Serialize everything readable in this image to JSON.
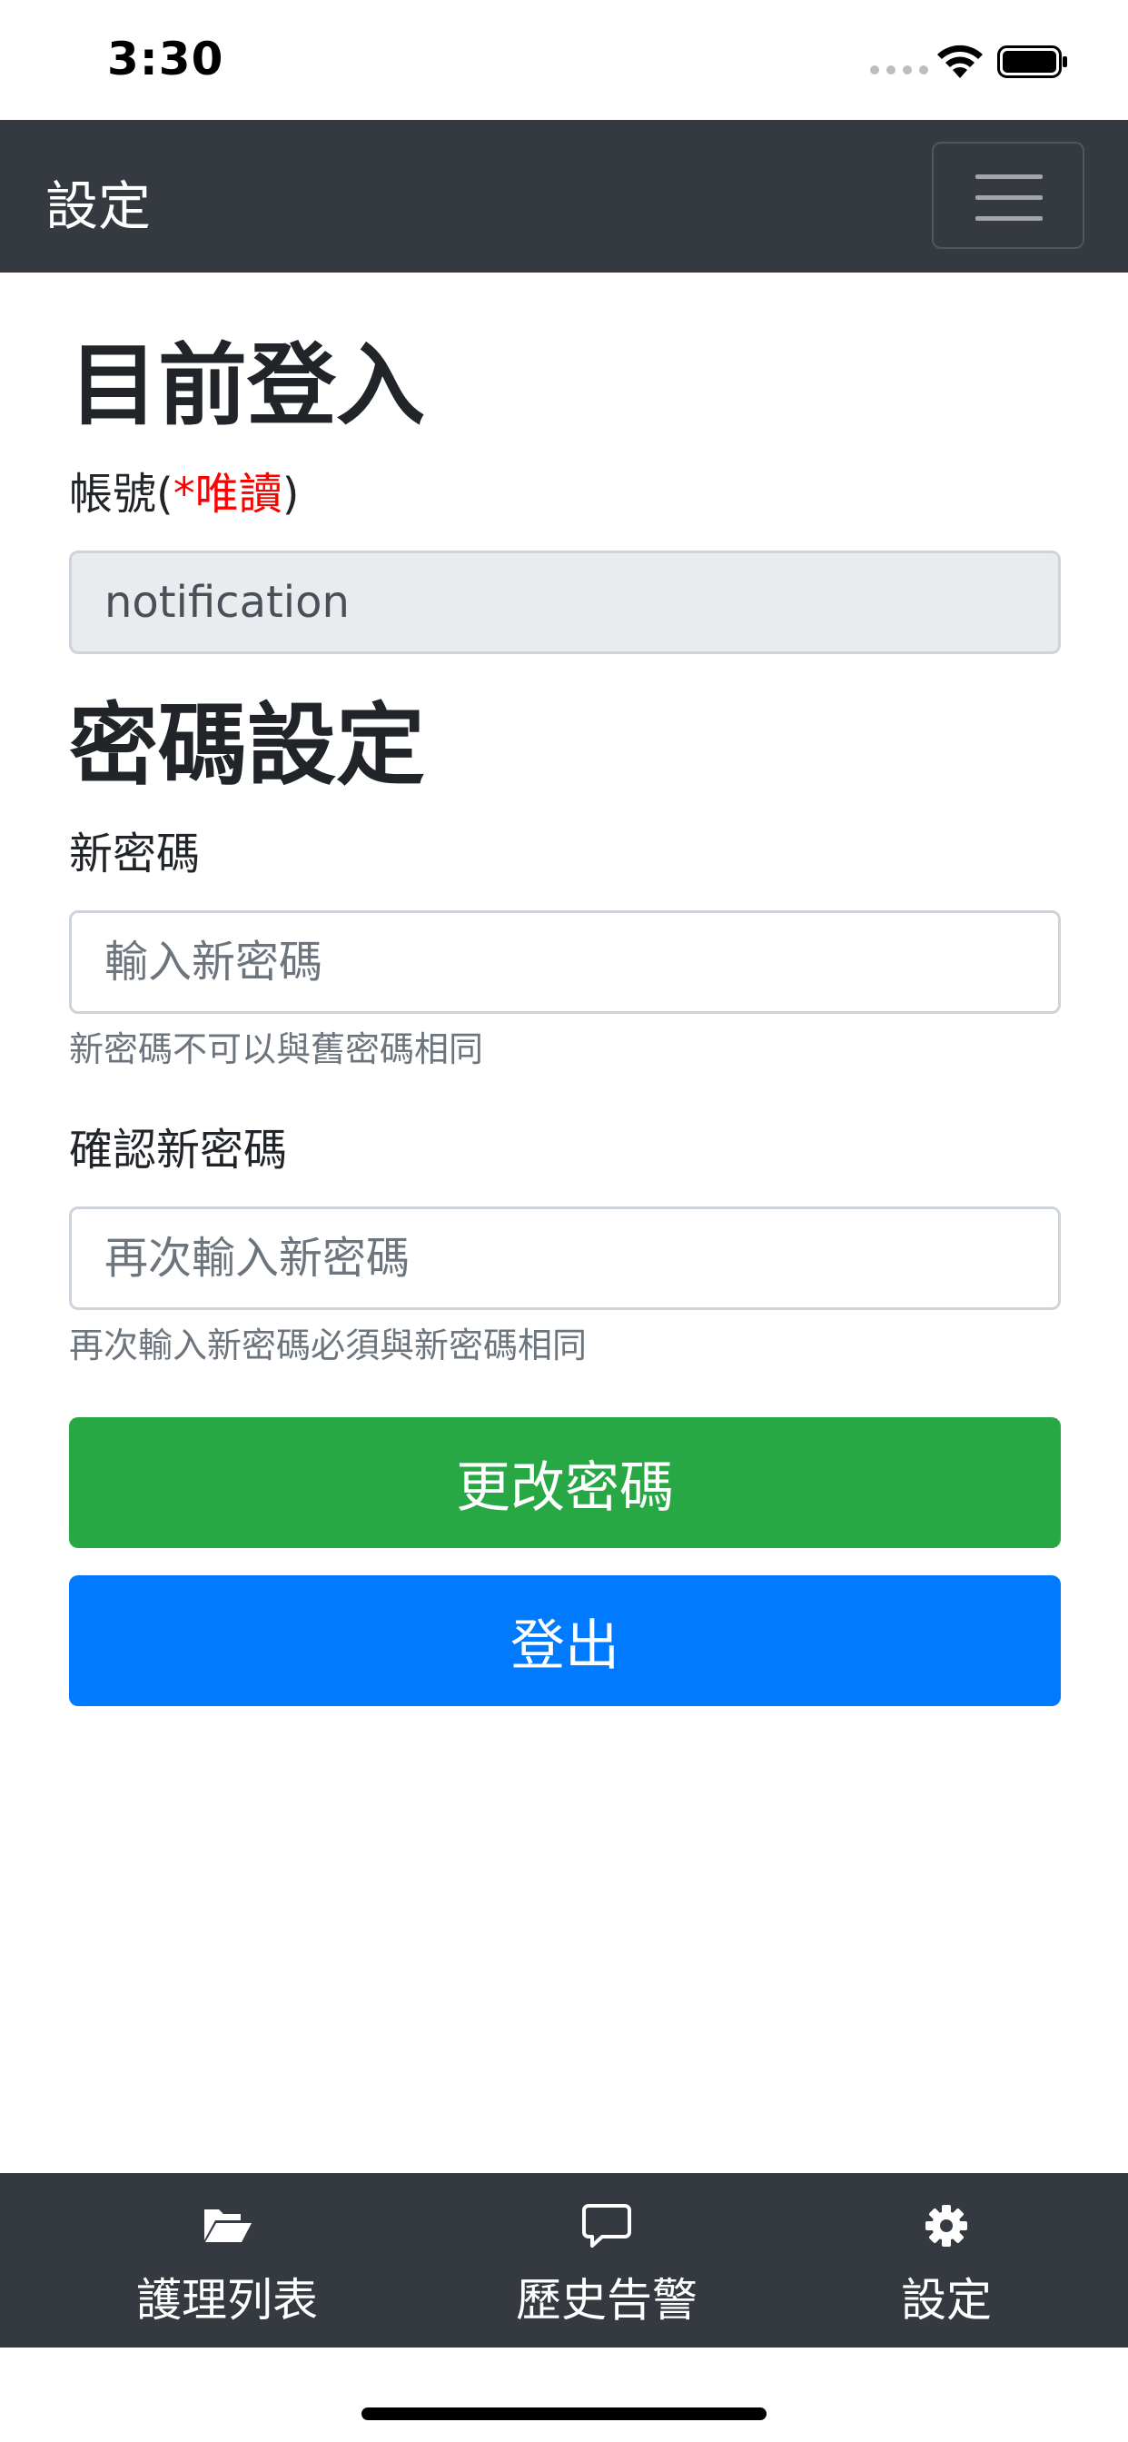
{
  "status_bar": {
    "time": "3:30"
  },
  "navbar": {
    "title": "設定",
    "menu_icon": "hamburger-icon"
  },
  "current_login": {
    "heading": "目前登入",
    "account_label": "帳號(",
    "readonly_note": "*唯讀",
    "account_label_close": ")",
    "account_value": "notification"
  },
  "password": {
    "heading": "密碼設定",
    "new_label": "新密碼",
    "new_placeholder": "輸入新密碼",
    "new_help": "新密碼不可以與舊密碼相同",
    "confirm_label": "確認新密碼",
    "confirm_placeholder": "再次輸入新密碼",
    "confirm_help": "再次輸入新密碼必須與新密碼相同"
  },
  "buttons": {
    "change_password": "更改密碼",
    "logout": "登出"
  },
  "tabbar": {
    "tabs": [
      {
        "label": "護理列表",
        "icon": "folder-open-icon"
      },
      {
        "label": "歷史告警",
        "icon": "chat-bubble-icon"
      },
      {
        "label": "設定",
        "icon": "gear-icon"
      }
    ]
  },
  "colors": {
    "navbar_bg": "#343a40",
    "success": "#28a745",
    "primary": "#007bff",
    "required": "#ff0000"
  }
}
